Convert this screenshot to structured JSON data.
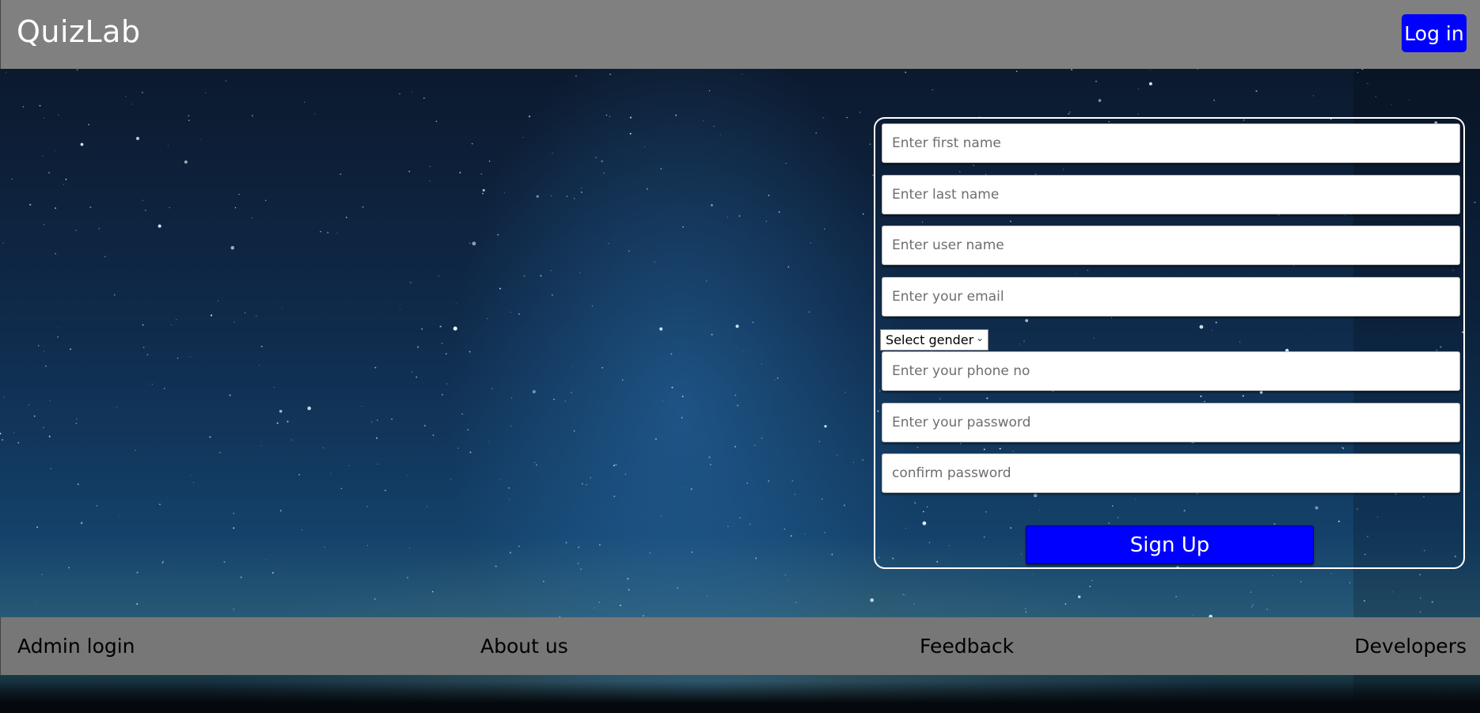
{
  "header": {
    "brand": "QuizLab",
    "login_label": "Log in"
  },
  "form": {
    "first_name_placeholder": "Enter first name",
    "last_name_placeholder": "Enter last name",
    "user_name_placeholder": "Enter user name",
    "email_placeholder": "Enter your email",
    "gender_selected": "Select gender",
    "phone_placeholder": "Enter your phone no",
    "password_placeholder": "Enter your password",
    "confirm_placeholder": "confirm password",
    "submit_label": "Sign Up"
  },
  "footer": {
    "links": [
      "Admin login",
      "About us",
      "Feedback",
      "Developers"
    ]
  },
  "colors": {
    "bar": "#808080",
    "accent": "#0000ff"
  }
}
